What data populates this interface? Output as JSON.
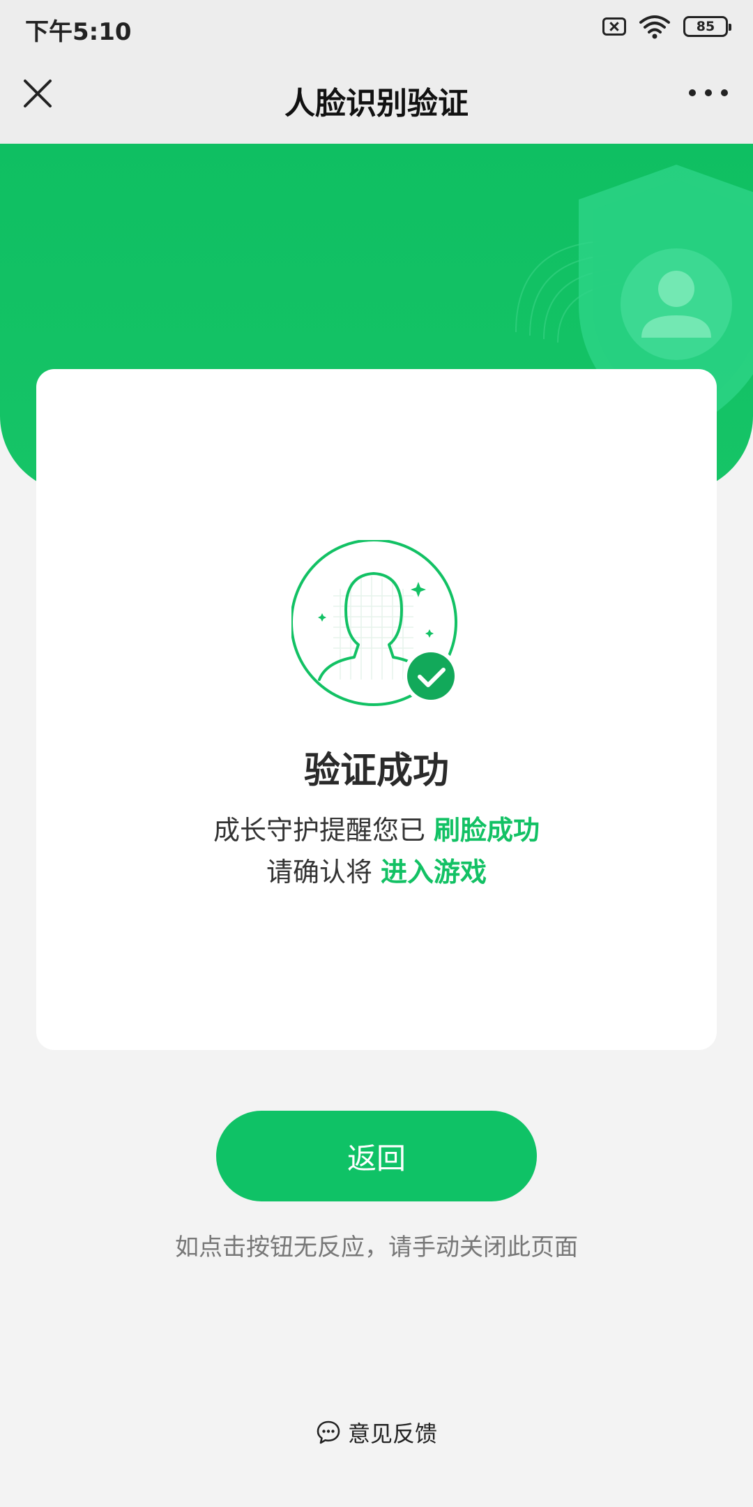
{
  "status_bar": {
    "time": "下午5:10",
    "battery": "85"
  },
  "nav": {
    "title": "人脸识别验证",
    "close_icon": "close-icon",
    "more_icon": "more-icon"
  },
  "card": {
    "title": "验证成功",
    "line1_prefix": "成长守护提醒您已 ",
    "line1_highlight": "刷脸成功",
    "line2_prefix": "请确认将 ",
    "line2_highlight": "进入游戏"
  },
  "actions": {
    "back_label": "返回",
    "hint": "如点击按钮无反应，请手动关闭此页面"
  },
  "footer": {
    "feedback_label": "意见反馈",
    "feedback_icon": "chat-bubble-icon"
  },
  "colors": {
    "brand_green": "#0fc266",
    "banner_green": "#16c467",
    "highlight_green": "#12c164",
    "page_bg": "#f3f3f3",
    "nav_bg": "#ededed"
  }
}
